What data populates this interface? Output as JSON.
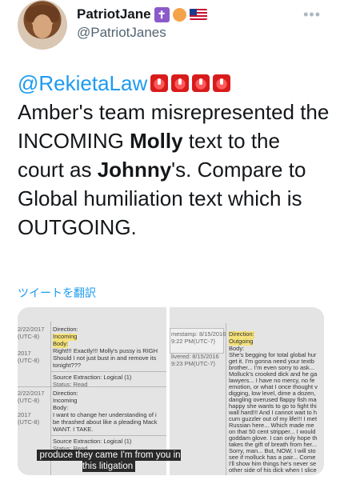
{
  "author": {
    "display_name": "PatriotJane",
    "handle": "@PatriotJanes",
    "badges": [
      "latin-cross-emoji",
      "peach-emoji",
      "us-flag-emoji"
    ],
    "avatar": "avatar"
  },
  "more_menu": "•••",
  "tweet": {
    "mention": "@RekietaLaw",
    "text_1": "Amber's team misrepresented the INCOMING ",
    "bold_1": "Molly",
    "text_2": " text to the court as ",
    "bold_2": "Johnny",
    "text_3": "'s.  Compare to Global humiliation text which is OUTGOING."
  },
  "translate_label": "ツイートを翻訳",
  "media": {
    "left": {
      "rows": [
        {
          "ts": "2/22/2017",
          "tz": "(UTC-8)",
          "k": "Direction:",
          "v": "Incoming"
        },
        {
          "ts": "2017",
          "tz": "(UTC-8)",
          "k": "Body:",
          "v": "Right!!! Exactly!!! Molly's pussy is RIGH"
        },
        {
          "ts": "",
          "tz": "",
          "k": "",
          "v": "Should I not just bust in and remove its"
        },
        {
          "ts": "",
          "tz": "",
          "k": "",
          "v": "tonight???"
        },
        {
          "ts": "",
          "tz": "",
          "k": "Source Extraction:",
          "v": "Logical (1)"
        },
        {
          "ts": "",
          "tz": "",
          "k": "Status:",
          "v": "Read"
        },
        {
          "ts": "2/22/2017",
          "tz": "(UTC-8)",
          "k": "Direction:",
          "v": "Incoming"
        },
        {
          "ts": "2017",
          "tz": "(UTC-8)",
          "k": "Body:",
          "v": "I want to change her understanding of i"
        },
        {
          "ts": "",
          "tz": "",
          "k": "",
          "v": "be thrashed about like a pleading Mack"
        },
        {
          "ts": "",
          "tz": "",
          "k": "",
          "v": "WANT. I TAKE."
        },
        {
          "ts": "",
          "tz": "",
          "k": "Source Extraction:",
          "v": "Logical (1)"
        },
        {
          "ts": "",
          "tz": "",
          "k": "Status:",
          "v": "Read"
        }
      ],
      "caption": "produce they came I'm from you in this litigation"
    },
    "right": {
      "timestamp_1": "mestamp: 8/15/2016",
      "timestamp_1b": "9:22 PM(UTC-7)",
      "delivered": "livered: 8/15/2016",
      "delivered_b": "9:23 PM(UTC-7)",
      "direction_label": "Direction:",
      "direction_value": "Outgoing",
      "body_label": "Body:",
      "body_lines": [
        "She's begging for total global hur",
        "get it.  I'm gonna need your textb",
        "brother... I'm even sorry to ask...",
        "Molluck's crooked dick and he ga",
        "lawyers... I have no mercy, no fe",
        "emotion, or what I once thought v",
        "digging, low level, dime a dozen,",
        "dangling overused flappy fish ma",
        "happy she wants to go to fight thi",
        "wall hard!!! And I cannot wait to h",
        "cum guzzler out of my life!!! I met",
        "Russian here... Which made me",
        "on that 50 cent stripper... I would",
        "goddam glove. I can only hope th",
        "takes the gift of breath from her...",
        "Sorry, man... But, NOW, I will sto",
        "see if molluck has a pair... Come",
        "I'll show him things he's never se",
        "other side of his dick when I slice"
      ]
    }
  }
}
